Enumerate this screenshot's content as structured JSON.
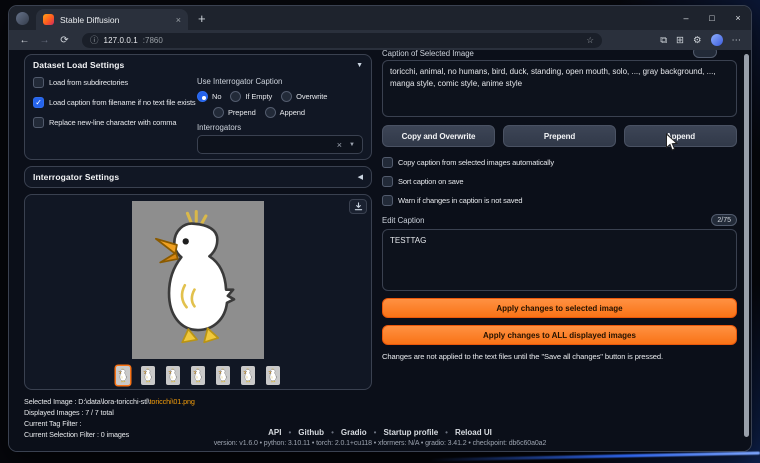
{
  "browser": {
    "tab_title": "Stable Diffusion",
    "new_tab": "+",
    "tab_close": "×",
    "url_host": "127.0.0.1",
    "url_port": ":7860",
    "controls": {
      "minimize": "–",
      "maximize": "□",
      "close": "×"
    }
  },
  "icons": {
    "back": "←",
    "forward": "→",
    "refresh": "⟳",
    "site_info": "ⓘ",
    "favorite": "☆",
    "split_screen": "⧉",
    "collections": "⊞",
    "extensions": "⚙",
    "menu": "⋯",
    "accordion_open": "▼",
    "accordion_closed": "◀",
    "dropdown_clear": "×",
    "dropdown_caret": "▼"
  },
  "dataset_load": {
    "title": "Dataset Load Settings",
    "checkboxes": [
      {
        "label": "Load from subdirectories",
        "checked": false
      },
      {
        "label": "Load caption from filename if no text file exists",
        "checked": true
      },
      {
        "label": "Replace new-line character with comma",
        "checked": false
      }
    ],
    "use_interrogator_caption": {
      "label": "Use Interrogator Caption",
      "options": [
        "No",
        "If Empty",
        "Overwrite",
        "Prepend",
        "Append"
      ],
      "selected": "No"
    },
    "interrogators_label": "Interrogators"
  },
  "interrogator_settings": {
    "title": "Interrogator Settings"
  },
  "viewer": {
    "thumbnails": 7,
    "selected_index": 1
  },
  "info": {
    "selected_image_prefix": "Selected Image : D:\\data\\lora-toricchi-stl\\",
    "selected_image_file": "toricchi\\01.png",
    "displayed_images": "Displayed Images : 7 / 7 total",
    "current_tag_filter": "Current Tag Filter :",
    "current_selection_filter": "Current Selection Filter : 0 images"
  },
  "caption": {
    "label": "Caption of Selected Image",
    "counter": "",
    "text": "toricchi, animal, no humans, bird, duck, standing, open mouth, solo, ..., gray background, ..., manga style, comic style, anime style",
    "copy_overwrite": "Copy and Overwrite",
    "prepend": "Prepend",
    "append": "Append",
    "auto_copy": "Copy caption from selected images automatically",
    "sort_on_save": "Sort caption on save",
    "warn_unsaved": "Warn if changes in caption is not saved",
    "edit_label": "Edit Caption",
    "edit_counter": "2/75",
    "edit_text": "TESTTAG",
    "apply_selected": "Apply changes to selected image",
    "apply_all": "Apply changes to ALL displayed images",
    "note": "Changes are not applied to the text files until the \"Save all changes\" button is pressed."
  },
  "footer": {
    "links": [
      "API",
      "Github",
      "Gradio",
      "Startup profile",
      "Reload UI"
    ],
    "separator": "•",
    "version_line": "version: v1.6.0  •  python: 3.10.11  •  torch: 2.0.1+cu118  •  xformers: N/A  •  gradio: 3.41.2  •  checkpoint: db6c60a0a2"
  },
  "colors": {
    "accent": "#f97316",
    "selected_control": "#2563eb"
  }
}
